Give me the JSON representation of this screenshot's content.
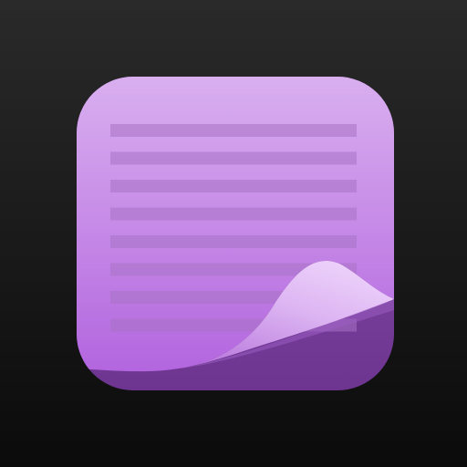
{
  "app_icon": {
    "icon": "notes-page-curl-icon",
    "line_count": 8,
    "colors": {
      "background_top": "#2a2a2a",
      "background_bottom": "#0b0b0b",
      "paper_top": "#d9afef",
      "paper_bottom": "#b366df",
      "rule_line": "#a872c4",
      "back_sheet_top": "#8b4fae",
      "back_sheet_bottom": "#6d3590",
      "curl_highlight": "#eed4fb",
      "curl_shadow": "#b978dc"
    }
  }
}
